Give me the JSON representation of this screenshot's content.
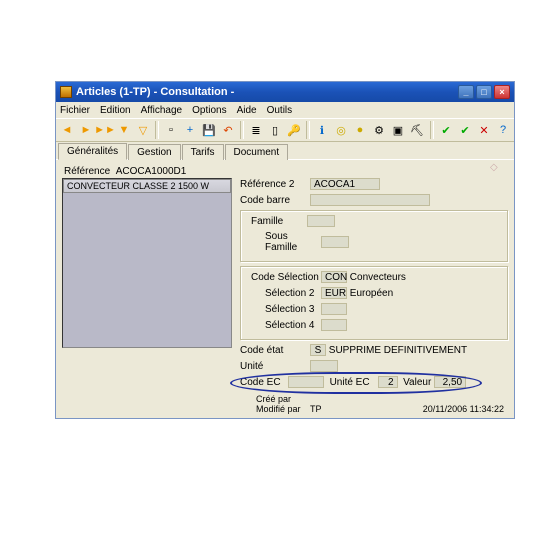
{
  "window": {
    "title": "Articles (1-TP) - Consultation -"
  },
  "menu": {
    "items": [
      "Fichier",
      "Edition",
      "Affichage",
      "Options",
      "Aide",
      "Outils"
    ]
  },
  "tabs": {
    "items": [
      "Généralités",
      "Gestion",
      "Tarifs",
      "Document"
    ],
    "active": 0
  },
  "ref": {
    "label": "Référence",
    "value": "ACOCA1000D1"
  },
  "list": {
    "item0": "CONVECTEUR CLASSE 2 1500 W"
  },
  "right": {
    "ref2_label": "Référence 2",
    "ref2_value": "ACOCA1",
    "codebarre_label": "Code barre",
    "famille_label": "Famille",
    "sousfamille_label": "Sous Famille",
    "codesel_label": "Code Sélection",
    "codesel_code": "CON",
    "codesel_text": "Convecteurs",
    "sel2_label": "Sélection 2",
    "sel2_code": "EUR",
    "sel2_text": "Européen",
    "sel3_label": "Sélection 3",
    "sel4_label": "Sélection 4",
    "codeetat_label": "Code état",
    "codeetat_code": "S",
    "codeetat_text": "SUPPRIME DEFINITIVEMENT",
    "unite_label": "Unité",
    "codeec_label": "Code EC",
    "uniteec_label": "Unité EC",
    "uniteec_value": "2",
    "valeur_label": "Valeur",
    "valeur_value": "2,50"
  },
  "footer": {
    "cree_label": "Créé par",
    "mod_label": "Modifié par",
    "mod_user": "TP",
    "timestamp": "20/11/2006 11:34:22"
  },
  "toolbar": {
    "back": "◄",
    "fwd": "►",
    "ffwd": "►►",
    "filter": "▼",
    "funnel": "▽",
    "new": "▫",
    "plus": "+",
    "save": "💾",
    "undo": "↶",
    "list": "≣",
    "edit": "▯",
    "key": "🔑",
    "info": "ℹ",
    "coin": "◎",
    "ball": "●",
    "gear": "⚙",
    "pkg": "▣",
    "tool": "⛏",
    "ok": "✔",
    "ok2": "✔",
    "no": "✕",
    "help": "?"
  }
}
